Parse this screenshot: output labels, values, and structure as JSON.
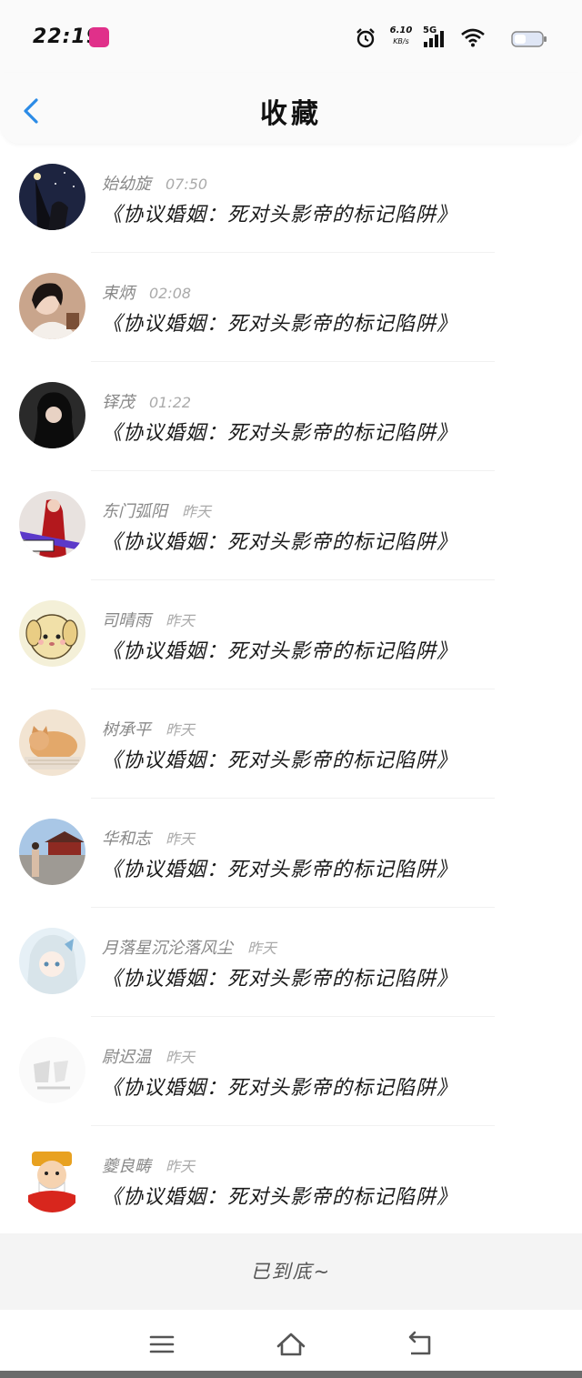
{
  "status_bar": {
    "time": "22:19",
    "net_speed": "6.10",
    "net_unit": "KB/s",
    "network": "5G",
    "icons": [
      "app-badge-icon",
      "alarm-icon",
      "signal-icon",
      "wifi-icon",
      "battery-icon"
    ]
  },
  "header": {
    "title": "收藏",
    "back_icon": "chevron-left-icon"
  },
  "accent_color": "#2b8be6",
  "items": [
    {
      "name": "始幼旋",
      "time": "07:50",
      "title": "《协议婚姻：死对头影帝的标记陷阱》",
      "avatar": "night-sky-portrait"
    },
    {
      "name": "束炳",
      "time": "02:08",
      "title": "《协议婚姻：死对头影帝的标记陷阱》",
      "avatar": "girl-portrait"
    },
    {
      "name": "铎茂",
      "time": "01:22",
      "title": "《协议婚姻：死对头影帝的标记陷阱》",
      "avatar": "dark-hair-portrait"
    },
    {
      "name": "东门弧阳",
      "time": "昨天",
      "title": "《协议婚姻：死对头影帝的标记陷阱》",
      "avatar": "red-dress-portrait"
    },
    {
      "name": "司晴雨",
      "time": "昨天",
      "title": "《协议婚姻：死对头影帝的标记陷阱》",
      "avatar": "cartoon-dog"
    },
    {
      "name": "树承平",
      "time": "昨天",
      "title": "《协议婚姻：死对头影帝的标记陷阱》",
      "avatar": "sleeping-cat"
    },
    {
      "name": "华和志",
      "time": "昨天",
      "title": "《协议婚姻：死对头影帝的标记陷阱》",
      "avatar": "palace-photo"
    },
    {
      "name": "月落星沉沦落风尘",
      "time": "昨天",
      "title": "《协议婚姻：死对头影帝的标记陷阱》",
      "avatar": "anime-girl"
    },
    {
      "name": "尉迟温",
      "time": "昨天",
      "title": "《协议婚姻：死对头影帝的标记陷阱》",
      "avatar": "faded-sketch"
    },
    {
      "name": "夔良畴",
      "time": "昨天",
      "title": "《协议婚姻：死对头影帝的标记陷阱》",
      "avatar": "fortune-god-cartoon"
    }
  ],
  "footer": {
    "end_text": "已到底~"
  },
  "system_nav": {
    "icons": [
      "menu-icon",
      "home-icon",
      "back-icon"
    ]
  }
}
